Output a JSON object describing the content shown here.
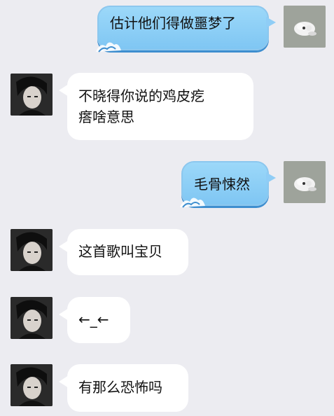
{
  "conversation": {
    "messages": [
      {
        "sender": "self",
        "text": "估计他们得做噩梦了"
      },
      {
        "sender": "friend",
        "text_line1": "不晓得你说的鸡皮疙",
        "text_line2": "瘩啥意思"
      },
      {
        "sender": "self",
        "text": "毛骨悚然"
      },
      {
        "sender": "friend",
        "text": "这首歌叫宝贝"
      },
      {
        "sender": "friend",
        "text": "←_←"
      },
      {
        "sender": "friend",
        "text": "有那么恐怖吗"
      }
    ]
  },
  "colors": {
    "background": "#ececf1",
    "incoming_bubble": "#ffffff",
    "outgoing_bubble": "#8fcdf6",
    "outgoing_shadow": "#3e8ecf"
  },
  "icons": {
    "friend_avatar": "friend-avatar-icon",
    "self_avatar": "self-avatar-icon",
    "wave_decoration": "wave-decoration-icon"
  }
}
